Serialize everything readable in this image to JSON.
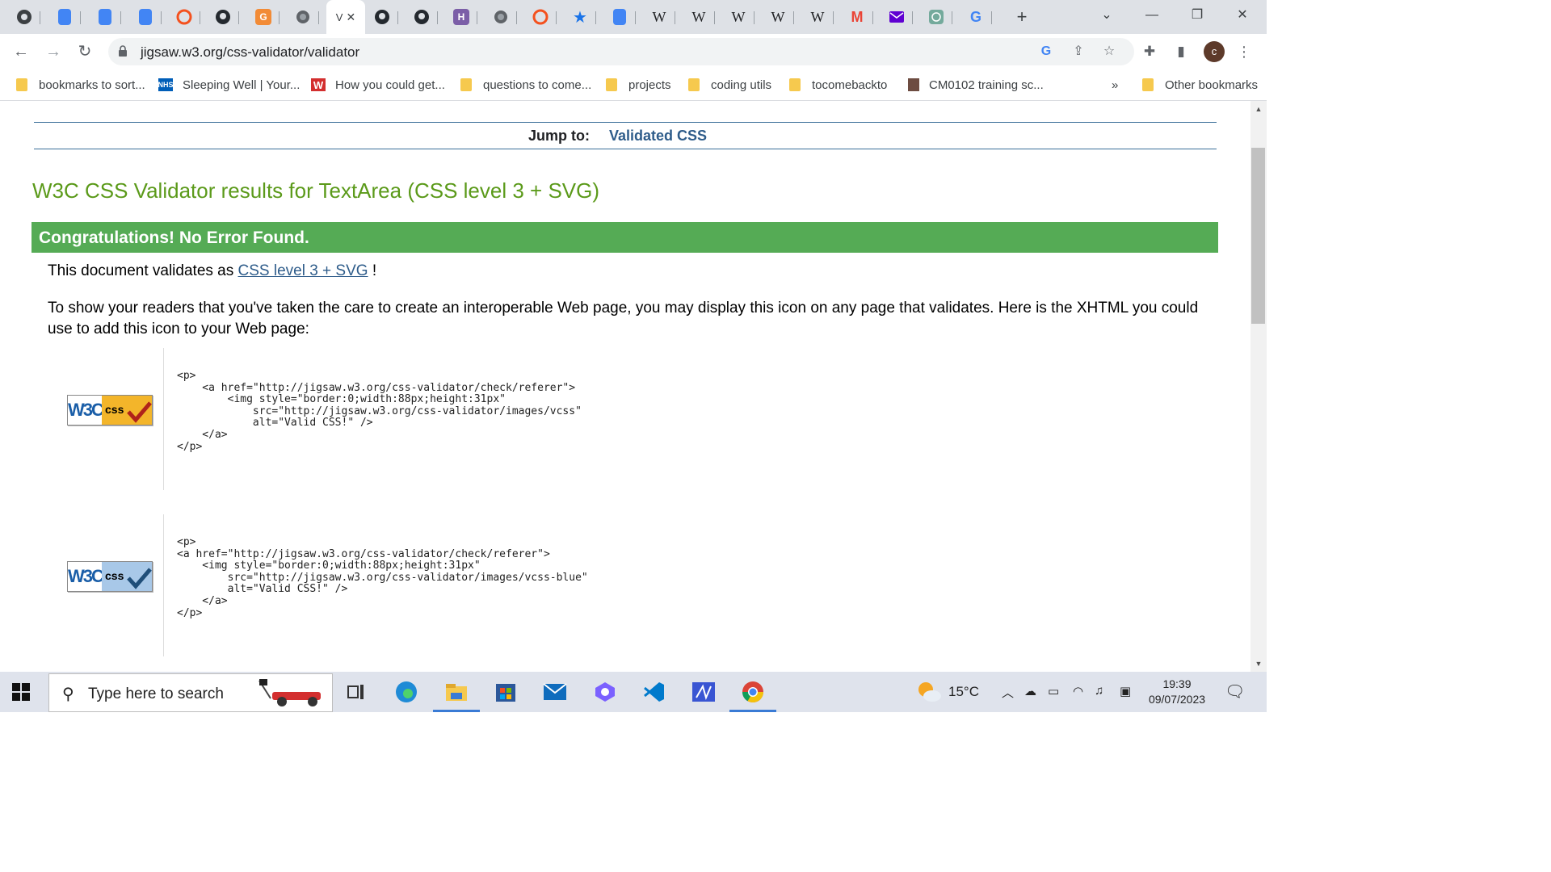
{
  "browser": {
    "active_tab_label": "V",
    "tabs": [
      {
        "icon": "chrome-icon"
      },
      {
        "icon": "google-docs-icon"
      },
      {
        "icon": "google-docs-icon"
      },
      {
        "icon": "google-docs-icon"
      },
      {
        "icon": "opera-icon"
      },
      {
        "icon": "github-icon"
      },
      {
        "icon": "g-orange-icon"
      },
      {
        "icon": "globe-icon"
      },
      {
        "icon": "w3c-tab-active"
      },
      {
        "icon": "github-icon"
      },
      {
        "icon": "github-icon"
      },
      {
        "icon": "h-purple-icon"
      },
      {
        "icon": "globe-icon"
      },
      {
        "icon": "opera-icon"
      },
      {
        "icon": "star-bookmark-icon"
      },
      {
        "icon": "google-docs-icon"
      },
      {
        "icon": "wikipedia-icon"
      },
      {
        "icon": "wikipedia-icon"
      },
      {
        "icon": "wikipedia-icon"
      },
      {
        "icon": "wikipedia-icon"
      },
      {
        "icon": "wikipedia-icon"
      },
      {
        "icon": "gmail-icon"
      },
      {
        "icon": "yahoo-mail-icon"
      },
      {
        "icon": "chatgpt-icon"
      },
      {
        "icon": "google-icon"
      }
    ],
    "new_tab_symbol": "+",
    "url": "jigsaw.w3.org/css-validator/validator",
    "profile_initial": "c",
    "wiki_letter": "W",
    "gmail_letter": "M",
    "google_letter": "G",
    "h_letter": "H"
  },
  "bookmarks": [
    {
      "label": "bookmarks to sort...",
      "icon": "folder-icon"
    },
    {
      "label": "Sleeping Well | Your...",
      "icon": "nhs-icon",
      "icon_text": "NHS"
    },
    {
      "label": "How you could get...",
      "icon": "w-red-icon",
      "icon_text": "W"
    },
    {
      "label": "questions to come...",
      "icon": "folder-icon"
    },
    {
      "label": "projects",
      "icon": "folder-icon"
    },
    {
      "label": "coding utils",
      "icon": "folder-icon"
    },
    {
      "label": "tocomebackto",
      "icon": "folder-icon"
    },
    {
      "label": "CM0102 training sc...",
      "icon": "document-icon"
    }
  ],
  "bookmarks_overflow": "»",
  "other_bookmarks": "Other bookmarks",
  "page": {
    "jump_label": "Jump to:",
    "jump_link": "Validated CSS",
    "title": "W3C CSS Validator results for TextArea (CSS level 3 + SVG)",
    "congrats": "Congratulations! No Error Found.",
    "validates_prefix": "This document validates as ",
    "validates_link": "CSS level 3 + SVG",
    "validates_suffix": " !",
    "show_readers": "To show your readers that you've taken the care to create an interoperable Web page, you may display this icon on any page that validates. Here is the XHTML you could use to add this icon to your Web page:",
    "badge_w3c": "W3C",
    "badge_css": "css",
    "code_gold": "<p>\n    <a href=\"http://jigsaw.w3.org/css-validator/check/referer\">\n        <img style=\"border:0;width:88px;height:31px\"\n            src=\"http://jigsaw.w3.org/css-validator/images/vcss\"\n            alt=\"Valid CSS!\" />\n    </a>\n</p>",
    "code_blue": "<p>\n<a href=\"http://jigsaw.w3.org/css-validator/check/referer\">\n    <img style=\"border:0;width:88px;height:31px\"\n        src=\"http://jigsaw.w3.org/css-validator/images/vcss-blue\"\n        alt=\"Valid CSS!\" />\n    </a>\n</p>"
  },
  "taskbar": {
    "search_placeholder": "Type here to search",
    "temperature": "15°C",
    "time": "19:39",
    "date": "09/07/2023"
  },
  "colors": {
    "title_green": "#5b9a1a",
    "congrats_green": "#55ab55",
    "link_blue": "#2e5c8a",
    "tabstrip": "#dee1e6"
  }
}
